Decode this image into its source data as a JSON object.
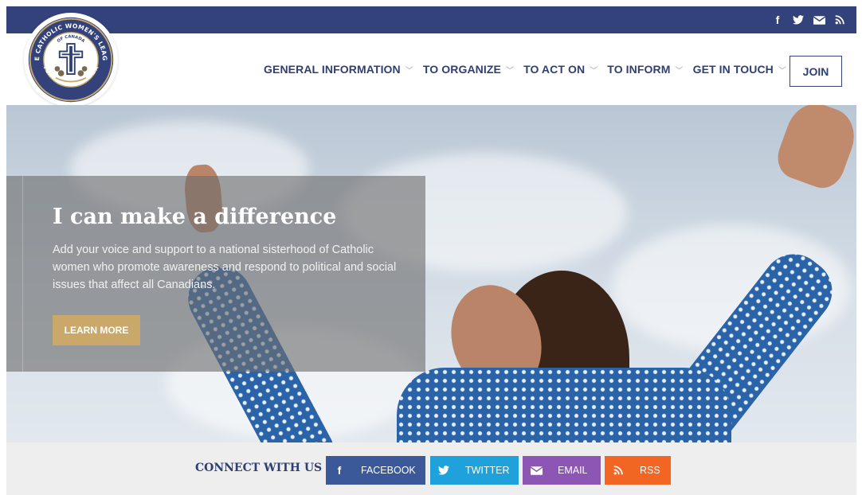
{
  "top_social": [
    {
      "icon": "facebook-icon",
      "glyph": "f"
    },
    {
      "icon": "twitter-icon",
      "glyph": "🐦"
    },
    {
      "icon": "email-icon",
      "glyph": "✉"
    },
    {
      "icon": "rss-icon",
      "glyph": "◔"
    }
  ],
  "logo": {
    "ring_top": "THE CATHOLIC WOMEN'S LEAGUE",
    "ring_inner": "OF CANADA",
    "ring_bottom": "FOR GOD AND CANADA"
  },
  "nav": {
    "items": [
      {
        "label": "GENERAL INFORMATION"
      },
      {
        "label": "TO ORGANIZE"
      },
      {
        "label": "TO ACT ON"
      },
      {
        "label": "TO INFORM"
      },
      {
        "label": "GET IN TOUCH"
      }
    ],
    "chevron": "﹀",
    "join_label": "JOIN"
  },
  "hero": {
    "title": "I can make a difference",
    "text": "Add your voice and support to a national sisterhood of Catholic women who promote awareness and respond to political and social issues that affect all Canadians.",
    "button_label": "LEARN MORE"
  },
  "connect": {
    "label": "CONNECT WITH US",
    "buttons": [
      {
        "label": "FACEBOOK",
        "glyph": "f",
        "color": "#3b5998"
      },
      {
        "label": "TWITTER",
        "glyph": "🐦",
        "color": "#1fa1db"
      },
      {
        "label": "EMAIL",
        "glyph": "✉",
        "color": "#8d55b4"
      },
      {
        "label": "RSS",
        "glyph": "◔",
        "color": "#f26522"
      }
    ]
  },
  "colors": {
    "navy": "#33427a",
    "gold": "#c9a86a"
  }
}
